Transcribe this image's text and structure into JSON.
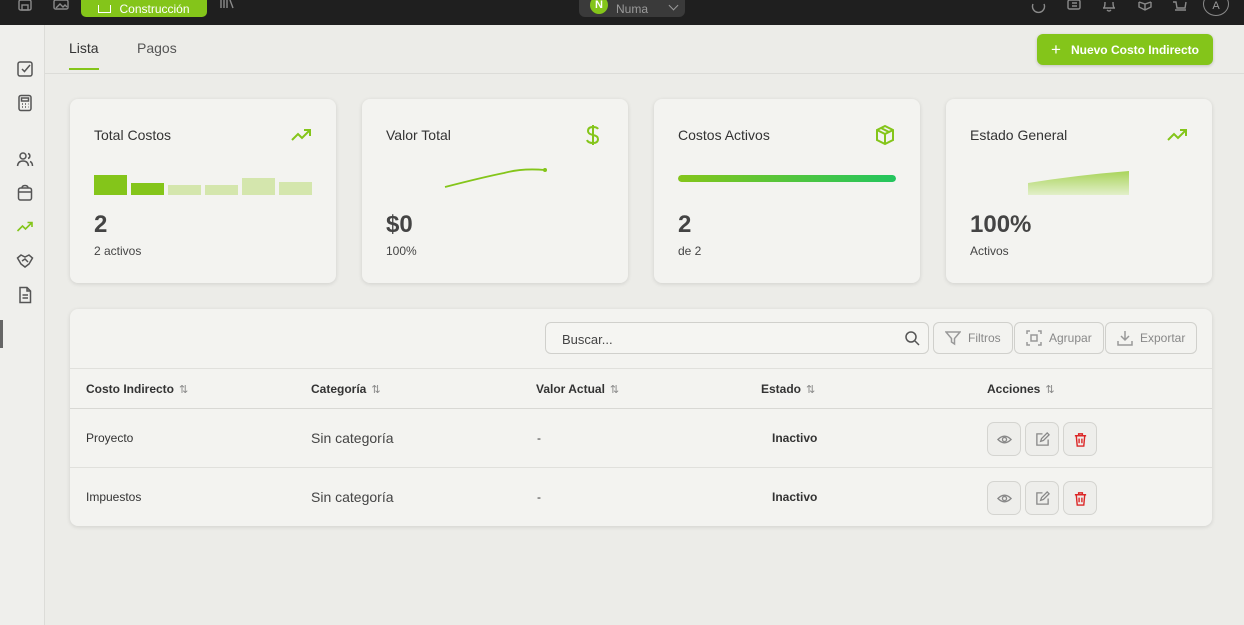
{
  "topbar": {
    "active_module": "Construcción",
    "org_name": "Numa",
    "org_initial": "N",
    "avatar_initial": "A"
  },
  "tabs": [
    {
      "label": "Lista",
      "active": true
    },
    {
      "label": "Pagos",
      "active": false
    }
  ],
  "new_button_label": "Nuevo Costo Indirecto",
  "accent_color": "#84c51a",
  "cards": {
    "total": {
      "title": "Total Costos",
      "value": "2",
      "subtitle": "2 activos",
      "icon": "trending-up-icon"
    },
    "valor": {
      "title": "Valor Total",
      "value": "$0",
      "subtitle": "100%",
      "icon": "dollar-icon"
    },
    "activos": {
      "title": "Costos Activos",
      "value": "2",
      "subtitle": "de 2",
      "icon": "box-icon",
      "progress": 1.0
    },
    "estado": {
      "title": "Estado General",
      "value": "100%",
      "subtitle": "Activos",
      "icon": "trending-up-icon"
    }
  },
  "table": {
    "search_placeholder": "Buscar...",
    "filters_label": "Filtros",
    "group_label": "Agrupar",
    "export_label": "Exportar",
    "columns": [
      "Costo Indirecto",
      "Categoría",
      "Valor Actual",
      "Estado",
      "Acciones"
    ],
    "rows": [
      {
        "name": "Proyecto",
        "category": "Sin categoría",
        "value": "-",
        "status": "Inactivo"
      },
      {
        "name": "Impuestos",
        "category": "Sin categoría",
        "value": "-",
        "status": "Inactivo"
      }
    ]
  }
}
